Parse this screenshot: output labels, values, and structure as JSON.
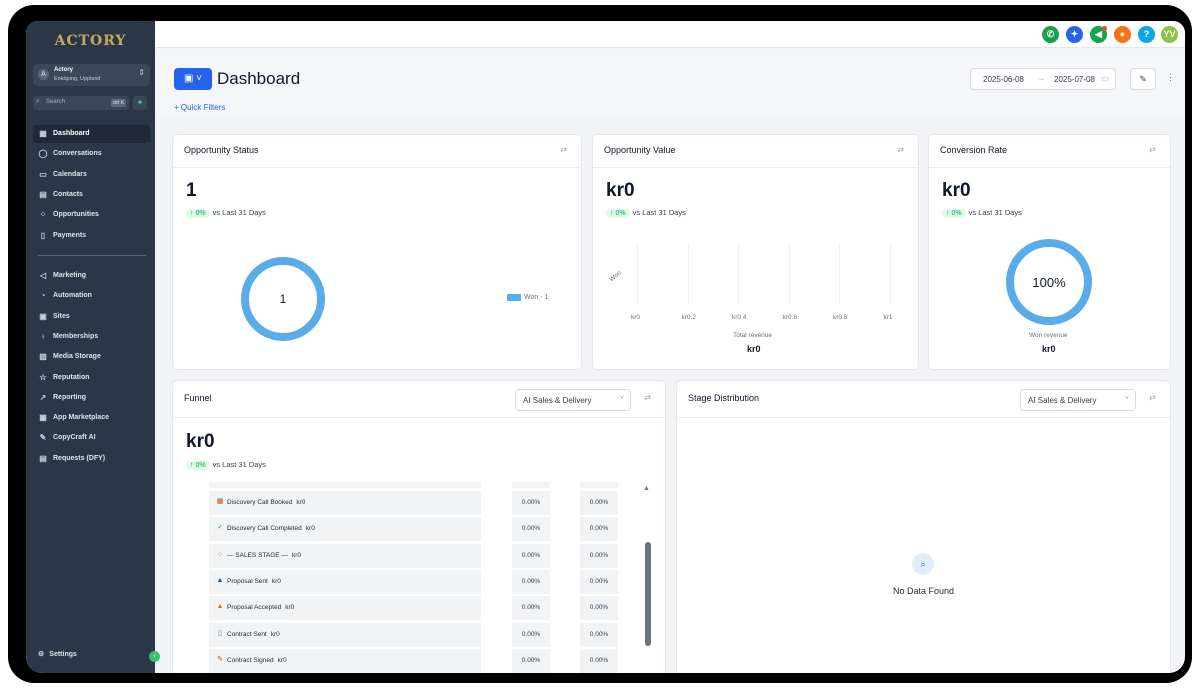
{
  "sidebar": {
    "logo": "ACTORY",
    "account": {
      "name": "Actory",
      "location": "Enköping, Uppland",
      "avatar": "A"
    },
    "search": {
      "placeholder": "Search",
      "shortcut": "ctrl K"
    },
    "items_top": [
      {
        "label": "Dashboard",
        "icon": "grid-icon",
        "glyph": "▦",
        "active": true
      },
      {
        "label": "Conversations",
        "icon": "chat-icon",
        "glyph": "◯"
      },
      {
        "label": "Calendars",
        "icon": "calendar-icon",
        "glyph": "▭"
      },
      {
        "label": "Contacts",
        "icon": "contacts-icon",
        "glyph": "▤"
      },
      {
        "label": "Opportunities",
        "icon": "opportunities-icon",
        "glyph": "⁘"
      },
      {
        "label": "Payments",
        "icon": "payments-icon",
        "glyph": "▯"
      }
    ],
    "items_bottom": [
      {
        "label": "Marketing",
        "icon": "send-icon",
        "glyph": "◁"
      },
      {
        "label": "Automation",
        "icon": "automation-icon",
        "glyph": "◔"
      },
      {
        "label": "Sites",
        "icon": "sites-icon",
        "glyph": "▣"
      },
      {
        "label": "Memberships",
        "icon": "memberships-icon",
        "glyph": "♀"
      },
      {
        "label": "Media Storage",
        "icon": "media-icon",
        "glyph": "▨"
      },
      {
        "label": "Reputation",
        "icon": "star-icon",
        "glyph": "☆"
      },
      {
        "label": "Reporting",
        "icon": "reporting-icon",
        "glyph": "↗"
      },
      {
        "label": "App Marketplace",
        "icon": "marketplace-icon",
        "glyph": "▦"
      },
      {
        "label": "CopyCraft AI",
        "icon": "pen-icon",
        "glyph": "✎"
      },
      {
        "label": "Requests (DFY)",
        "icon": "requests-icon",
        "glyph": "▤"
      }
    ],
    "settings": "Settings"
  },
  "topbar": {
    "icons": [
      {
        "name": "phone-icon",
        "glyph": "✆",
        "color": "#16a34a"
      },
      {
        "name": "magic-icon",
        "glyph": "✦",
        "color": "#2563eb"
      },
      {
        "name": "megaphone-icon",
        "glyph": "◀",
        "color": "#16a34a"
      },
      {
        "name": "bell-icon",
        "glyph": "●",
        "color": "#f97316"
      },
      {
        "name": "help-icon",
        "glyph": "?",
        "color": "#0ea5e9"
      }
    ],
    "avatar": "YV",
    "avatar_color": "#8bc34a"
  },
  "header": {
    "title": "Dashboard",
    "quick_filters": "+ Quick Filters",
    "date_from": "2025-06-08",
    "date_to": "2025-07-08"
  },
  "opportunity_status": {
    "title": "Opportunity Status",
    "value": "1",
    "change": "↑ 0%",
    "change_label": "vs Last 31 Days",
    "donut_value": "1",
    "legend": "Won - 1"
  },
  "opportunity_value": {
    "title": "Opportunity Value",
    "value": "kr0",
    "change": "↑ 0%",
    "change_label": "vs Last 31 Days",
    "y_label": "Won",
    "x_ticks": [
      "kr0",
      "kr0.2",
      "kr0.4",
      "kr0.6",
      "kr0.8",
      "kr1"
    ],
    "footer_label": "Total revenue",
    "footer_value": "kr0"
  },
  "conversion_rate": {
    "title": "Conversion Rate",
    "value": "kr0",
    "change": "↑ 0%",
    "change_label": "vs Last 31 Days",
    "gauge_value": "100%",
    "footer_label": "Won revenue",
    "footer_value": "kr0"
  },
  "funnel": {
    "title": "Funnel",
    "pipeline": "AI Sales & Delivery",
    "value": "kr0",
    "change": "↑ 0%",
    "change_label": "vs Last 31 Days",
    "stages": [
      {
        "label": "Discovery Call Booked",
        "amount": "kr0",
        "icon": "calendar-icon",
        "glyph": "▦",
        "color": "#b45309",
        "p1": "0.00%",
        "p2": "0.00%"
      },
      {
        "label": "Discovery Call Completed",
        "amount": "kr0",
        "icon": "check-icon",
        "glyph": "✓",
        "color": "#16a34a",
        "p1": "0.00%",
        "p2": "0.00%"
      },
      {
        "label": "— SALES STAGE —",
        "amount": "kr0",
        "icon": "circle-icon",
        "glyph": "○",
        "color": "#ca8a04",
        "p1": "0.00%",
        "p2": "0.00%"
      },
      {
        "label": "Proposal Sent",
        "amount": "kr0",
        "icon": "outbox-icon",
        "glyph": "▲",
        "color": "#1d4ed8",
        "p1": "0.00%",
        "p2": "0.00%"
      },
      {
        "label": "Proposal Accepted",
        "amount": "kr0",
        "icon": "thumbs-up-icon",
        "glyph": "▲",
        "color": "#d97706",
        "p1": "0.00%",
        "p2": "0.00%"
      },
      {
        "label": "Contract Sent",
        "amount": "kr0",
        "icon": "document-icon",
        "glyph": "▯",
        "color": "#6b7280",
        "p1": "0.00%",
        "p2": "0.00%"
      },
      {
        "label": "Contract Signed",
        "amount": "kr0",
        "icon": "pen-icon",
        "glyph": "✎",
        "color": "#b45309",
        "p1": "0.00%",
        "p2": "0.00%"
      }
    ]
  },
  "stage_distribution": {
    "title": "Stage Distribution",
    "pipeline": "AI Sales & Delivery",
    "empty": "No Data Found"
  }
}
